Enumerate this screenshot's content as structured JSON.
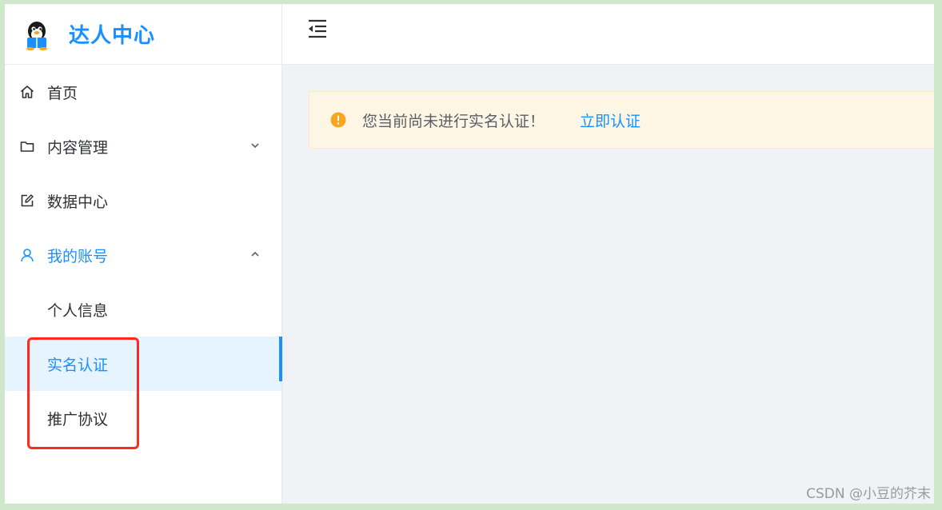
{
  "brand": {
    "title": "达人中心",
    "logo_icon": "qq-penguin-icon"
  },
  "header": {
    "toggle_icon": "menu-fold-icon"
  },
  "sidebar": {
    "items": [
      {
        "label": "首页",
        "icon": "home-icon"
      },
      {
        "label": "内容管理",
        "icon": "folder-icon",
        "expanded": false
      },
      {
        "label": "数据中心",
        "icon": "edit-icon"
      },
      {
        "label": "我的账号",
        "icon": "user-icon",
        "expanded": true,
        "children": [
          {
            "label": "个人信息"
          },
          {
            "label": "实名认证",
            "selected": true
          },
          {
            "label": "推广协议"
          }
        ]
      }
    ]
  },
  "alert": {
    "text": "您当前尚未进行实名认证！",
    "link": "立即认证",
    "icon": "warning-icon"
  },
  "watermark": "CSDN @小豆的芥末",
  "colors": {
    "accent": "#1890ff",
    "warning": "#f5a623",
    "highlight_box": "#ff2a1f"
  }
}
